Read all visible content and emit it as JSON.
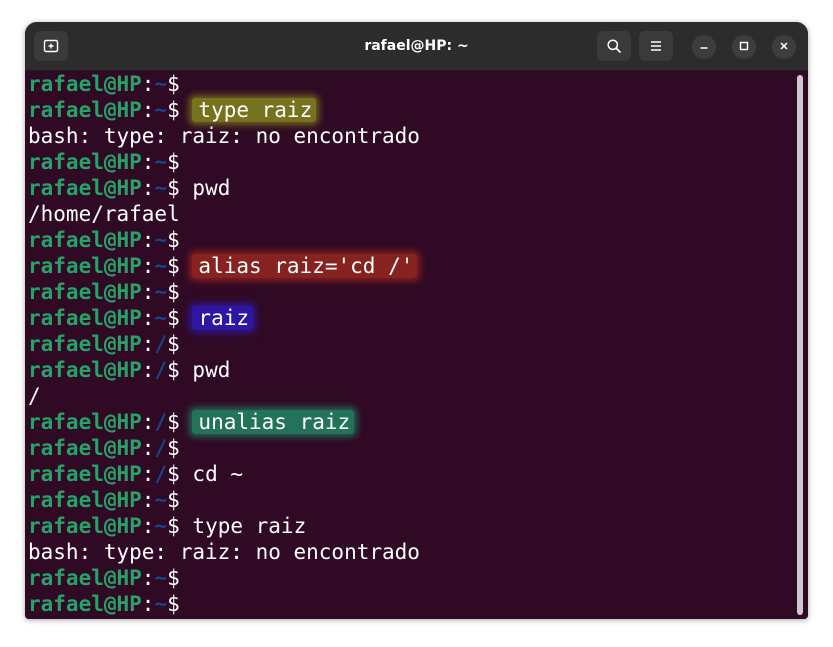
{
  "window": {
    "title": "rafael@HP: ~"
  },
  "titlebar": {
    "icons": [
      "new-tab-icon",
      "search-icon",
      "hamburger-menu-icon",
      "minimize-icon",
      "maximize-icon",
      "close-icon"
    ]
  },
  "colors": {
    "terminal_bg": "#300a24",
    "user": "#26a269",
    "path": "#12488b",
    "highlight_yellow": "#77721e",
    "highlight_red": "#86221f",
    "highlight_blue": "#2e16a4",
    "highlight_green": "#23725a"
  },
  "terminal": {
    "lines": [
      {
        "user": "rafael@HP",
        "sep": ":",
        "path": "~",
        "dollar": "$",
        "cmd": ""
      },
      {
        "user": "rafael@HP",
        "sep": ":",
        "path": "~",
        "dollar": "$",
        "cmd": "type raiz",
        "highlight": "yellow"
      },
      {
        "output": "bash: type: raiz: no encontrado"
      },
      {
        "user": "rafael@HP",
        "sep": ":",
        "path": "~",
        "dollar": "$",
        "cmd": ""
      },
      {
        "user": "rafael@HP",
        "sep": ":",
        "path": "~",
        "dollar": "$",
        "cmd": "pwd"
      },
      {
        "output": "/home/rafael"
      },
      {
        "user": "rafael@HP",
        "sep": ":",
        "path": "~",
        "dollar": "$",
        "cmd": ""
      },
      {
        "user": "rafael@HP",
        "sep": ":",
        "path": "~",
        "dollar": "$",
        "cmd": "alias raiz='cd /'",
        "highlight": "red"
      },
      {
        "user": "rafael@HP",
        "sep": ":",
        "path": "~",
        "dollar": "$",
        "cmd": ""
      },
      {
        "user": "rafael@HP",
        "sep": ":",
        "path": "~",
        "dollar": "$",
        "cmd": "raiz",
        "highlight": "blue"
      },
      {
        "user": "rafael@HP",
        "sep": ":",
        "path": "/",
        "dollar": "$",
        "cmd": ""
      },
      {
        "user": "rafael@HP",
        "sep": ":",
        "path": "/",
        "dollar": "$",
        "cmd": "pwd"
      },
      {
        "output": "/"
      },
      {
        "user": "rafael@HP",
        "sep": ":",
        "path": "/",
        "dollar": "$",
        "cmd": "unalias raiz",
        "highlight": "green"
      },
      {
        "user": "rafael@HP",
        "sep": ":",
        "path": "/",
        "dollar": "$",
        "cmd": ""
      },
      {
        "user": "rafael@HP",
        "sep": ":",
        "path": "/",
        "dollar": "$",
        "cmd": "cd ~"
      },
      {
        "user": "rafael@HP",
        "sep": ":",
        "path": "~",
        "dollar": "$",
        "cmd": ""
      },
      {
        "user": "rafael@HP",
        "sep": ":",
        "path": "~",
        "dollar": "$",
        "cmd": "type raiz"
      },
      {
        "output": "bash: type: raiz: no encontrado"
      },
      {
        "user": "rafael@HP",
        "sep": ":",
        "path": "~",
        "dollar": "$",
        "cmd": ""
      },
      {
        "user": "rafael@HP",
        "sep": ":",
        "path": "~",
        "dollar": "$",
        "cmd": ""
      }
    ]
  }
}
